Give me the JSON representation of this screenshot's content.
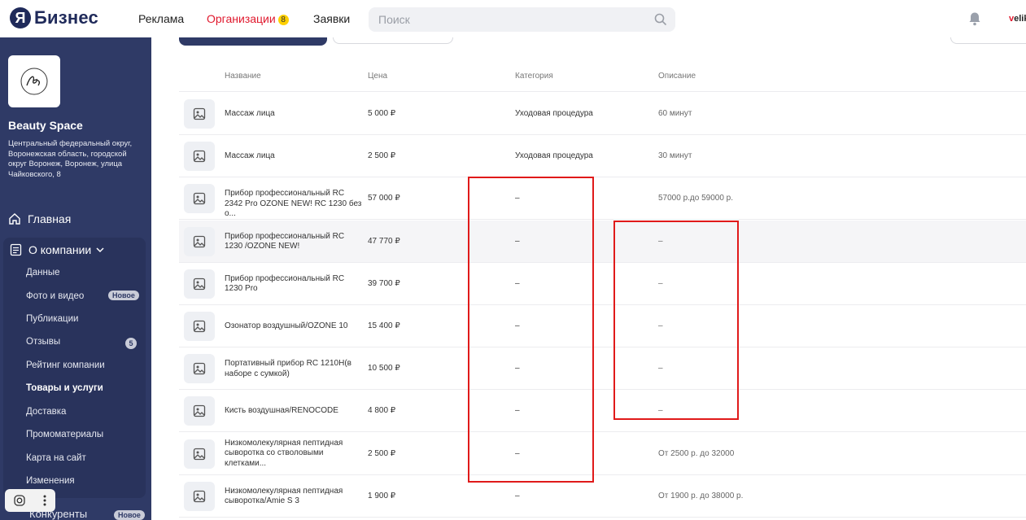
{
  "brand": {
    "badge": "Я",
    "name": "Бизнес",
    "brand_color": "#1f2a5a"
  },
  "nav": {
    "ads": "Реклама",
    "orgs": "Организации",
    "orgs_badge": "8",
    "requests": "Заявки",
    "active_color": "#e0182d"
  },
  "search": {
    "placeholder": "Поиск"
  },
  "user": {
    "first": "v",
    "rest": "elik"
  },
  "sidebar": {
    "bg_color": "#2f3a66",
    "org_name": "Beauty Space",
    "org_address": "Центральный федеральный округ, Воронежская область, городской округ Воронеж, Воронеж, улица Чайковского, 8",
    "main": "Главная",
    "about": "О компании",
    "items": [
      {
        "label": "Данные"
      },
      {
        "label": "Фото и видео",
        "badge": "Новое"
      },
      {
        "label": "Публикации"
      },
      {
        "label": "Отзывы",
        "count": "5"
      },
      {
        "label": "Рейтинг компании"
      },
      {
        "label": "Товары и услуги",
        "active": true
      },
      {
        "label": "Доставка"
      },
      {
        "label": "Промоматериалы"
      },
      {
        "label": "Карта на сайт"
      },
      {
        "label": "Изменения"
      }
    ],
    "competitors": "Конкуренты",
    "competitors_badge": "Новое"
  },
  "table": {
    "headers": {
      "name": "Название",
      "price": "Цена",
      "category": "Категория",
      "description": "Описание"
    },
    "rows": [
      {
        "name": "Массаж лица",
        "price": "5 000 ₽",
        "category": "Уходовая процедура",
        "description": "60 минут"
      },
      {
        "name": "Массаж лица",
        "price": "2 500 ₽",
        "category": "Уходовая процедура",
        "description": "30 минут"
      },
      {
        "name": "Прибор профессиональный RC 2342 Pro OZONE NEW! RC 1230 без о...",
        "price": "57 000 ₽",
        "category": "–",
        "description": "57000 р.до 59000 р."
      },
      {
        "name": "Прибор профессиональный RC 1230 /OZONE NEW!",
        "price": "47 770 ₽",
        "category": "–",
        "description": "–"
      },
      {
        "name": "Прибор профессиональный RC 1230 Pro",
        "price": "39 700 ₽",
        "category": "–",
        "description": "–"
      },
      {
        "name": "Озонатор воздушный/OZONE 10",
        "price": "15 400 ₽",
        "category": "–",
        "description": "–"
      },
      {
        "name": "Портативный прибор RC 1210H(в наборе с сумкой)",
        "price": "10 500 ₽",
        "category": "–",
        "description": "–"
      },
      {
        "name": "Кисть воздушная/RENOCODE",
        "price": "4 800 ₽",
        "category": "–",
        "description": "–"
      },
      {
        "name": "Низкомолекулярная пептидная сыворотка со стволовыми клетками...",
        "price": "2 500 ₽",
        "category": "–",
        "description": "От 2500 р. до 32000"
      },
      {
        "name": "Низкомолекулярная пептидная сыворотка/Amie S 3",
        "price": "1 900 ₽",
        "category": "–",
        "description": "От 1900 р. до 38000 р."
      }
    ]
  },
  "annotation_color": "#e01a1a"
}
